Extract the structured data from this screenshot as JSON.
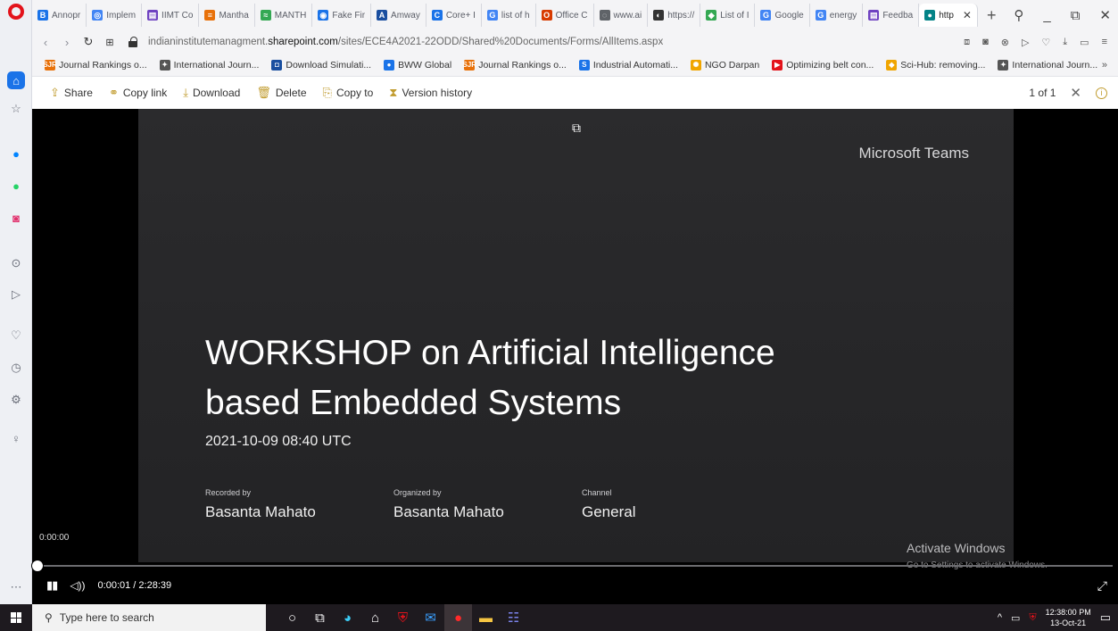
{
  "browser": {
    "tabs": [
      {
        "label": "Annopr",
        "icon": "B",
        "color": "#1a73e8"
      },
      {
        "label": "Implem",
        "icon": "◎",
        "color": "#4285f4"
      },
      {
        "label": "IIMT Co",
        "icon": "▤",
        "color": "#6f42c1"
      },
      {
        "label": "Mantha",
        "icon": "≡",
        "color": "#e8710a"
      },
      {
        "label": "MANTH",
        "icon": "≈",
        "color": "#34a853"
      },
      {
        "label": "Fake Fir",
        "icon": "◉",
        "color": "#1a73e8"
      },
      {
        "label": "Amway",
        "icon": "A",
        "color": "#1a4fa0"
      },
      {
        "label": "Core+ I",
        "icon": "C",
        "color": "#1a73e8"
      },
      {
        "label": "list of h",
        "icon": "G",
        "color": "#4285f4"
      },
      {
        "label": "Office C",
        "icon": "O",
        "color": "#d83b01"
      },
      {
        "label": "www.ai",
        "icon": "◌",
        "color": "#5f6368"
      },
      {
        "label": "https://",
        "icon": "◐",
        "color": "#333333"
      },
      {
        "label": "List of I",
        "icon": "◆",
        "color": "#34a853"
      },
      {
        "label": "Google",
        "icon": "G",
        "color": "#4285f4"
      },
      {
        "label": "energy",
        "icon": "G",
        "color": "#4285f4"
      },
      {
        "label": "Feedba",
        "icon": "▤",
        "color": "#6f42c1"
      },
      {
        "label": "http",
        "icon": "●",
        "color": "#038387",
        "active": true
      }
    ],
    "url_prefix": "indianinstitutemanagment.",
    "url_domain": "sharepoint.com",
    "url_path": "/sites/ECE4A2021-22ODD/Shared%20Documents/Forms/AllItems.aspx",
    "bookmarks": [
      {
        "label": "Journal Rankings o...",
        "icon": "SJR",
        "color": "#e8710a"
      },
      {
        "label": "International Journ...",
        "icon": "✦",
        "color": "#555555"
      },
      {
        "label": "Download Simulati...",
        "icon": "◘",
        "color": "#1a4fa0"
      },
      {
        "label": "BWW Global",
        "icon": "●",
        "color": "#1a73e8"
      },
      {
        "label": "Journal Rankings o...",
        "icon": "SJR",
        "color": "#e8710a"
      },
      {
        "label": "Industrial Automati...",
        "icon": "S",
        "color": "#1a73e8"
      },
      {
        "label": "NGO Darpan",
        "icon": "✺",
        "color": "#f0a500"
      },
      {
        "label": "Optimizing belt con...",
        "icon": "▶",
        "color": "#e3131b"
      },
      {
        "label": "Sci-Hub: removing...",
        "icon": "◆",
        "color": "#f0a500"
      },
      {
        "label": "International Journ...",
        "icon": "✦",
        "color": "#555555"
      }
    ],
    "bookmarks_more": "»"
  },
  "commands": {
    "share": "Share",
    "copy_link": "Copy link",
    "download": "Download",
    "delete": "Delete",
    "copy_to": "Copy to",
    "version_history": "Version history",
    "pager": "1 of 1"
  },
  "video": {
    "brand": "Microsoft Teams",
    "title_line1": "WORKSHOP on Artificial Intelligence",
    "title_line2": "based Embedded Systems",
    "date": "2021-10-09 08:40 UTC",
    "recorded_by_label": "Recorded by",
    "recorded_by": "Basanta Mahato",
    "organized_by_label": "Organized by",
    "organized_by": "Basanta Mahato",
    "channel_label": "Channel",
    "channel": "General",
    "hover_time": "0:00:00",
    "current_time": "0:00:01",
    "duration": "2:28:39",
    "progress": 0.0001,
    "activate_title": "Activate Windows",
    "activate_sub": "Go to Settings to activate Windows."
  },
  "taskbar": {
    "search_placeholder": "Type here to search",
    "time": "12:38:00 PM",
    "date": "13-Oct-21"
  }
}
